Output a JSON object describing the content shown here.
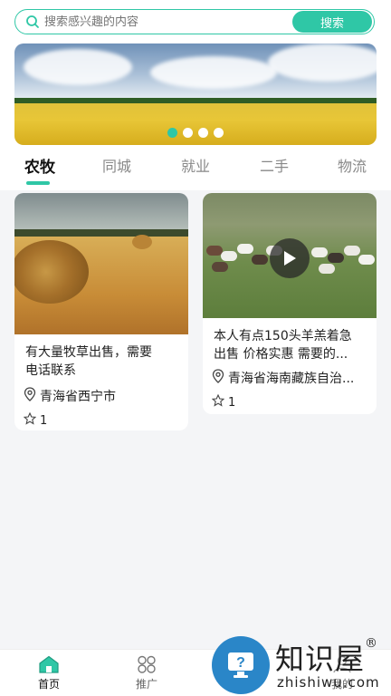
{
  "search": {
    "placeholder": "搜索感兴趣的内容",
    "button_label": "搜索",
    "icon": "search-icon"
  },
  "banner": {
    "slide_count": 4,
    "active_index": 0
  },
  "tabs": [
    {
      "label": "农牧",
      "active": true
    },
    {
      "label": "同城",
      "active": false
    },
    {
      "label": "就业",
      "active": false
    },
    {
      "label": "二手",
      "active": false
    },
    {
      "label": "物流",
      "active": false
    }
  ],
  "posts": [
    {
      "title_lines": [
        "有大量牧草出售，需要",
        "电话联系"
      ],
      "location": "青海省西宁市",
      "likes": "1",
      "is_video": false
    },
    {
      "title_lines": [
        "本人有点150头羊羔着急",
        "出售 价格实惠 需要的..."
      ],
      "location": "青海省海南藏族自治...",
      "likes": "1",
      "is_video": true
    }
  ],
  "bottom_nav": [
    {
      "label": "首页",
      "icon": "home-icon",
      "active": true
    },
    {
      "label": "推广",
      "icon": "grid-icon",
      "active": false
    },
    {
      "label": "我的",
      "icon": "user-icon",
      "active": false
    }
  ],
  "watermark": {
    "title": "知识屋",
    "reg_mark": "®",
    "subtitle": "zhishiwu.com"
  },
  "colors": {
    "accent": "#2fc7a6",
    "watermark_blue": "#2a86c8"
  }
}
